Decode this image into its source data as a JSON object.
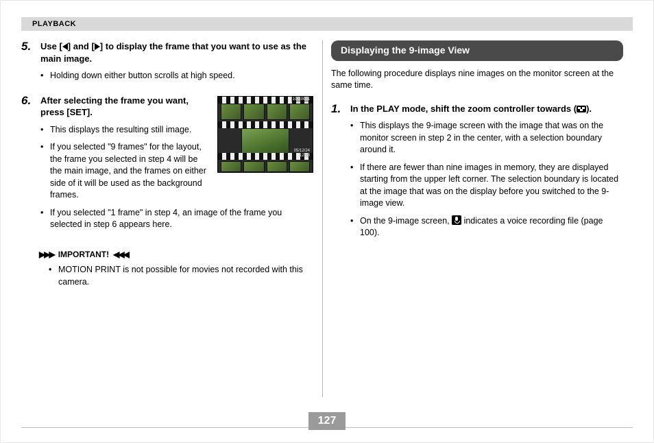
{
  "header": {
    "section": "PLAYBACK"
  },
  "page_number": "127",
  "left": {
    "step5": {
      "num": "5.",
      "head_pre": "Use [",
      "head_mid": "] and [",
      "head_post": "] to display the frame that you want to use as the main image.",
      "bullets": [
        "Holding down either button scrolls at high speed."
      ]
    },
    "step6": {
      "num": "6.",
      "head": "After selecting the frame you want, press [SET].",
      "bullets_a": [
        "This displays the resulting still image."
      ],
      "bullets_b": [
        "If you selected \"9 frames\" for the layout, the frame you selected in step 4 will be the main image, and the frames on either side of it will be used as the background frames.",
        "If you selected \"1 frame\" in step 4, an image of the frame you selected in step 6 appears here."
      ]
    },
    "thumb": {
      "top_overlay": "100-0001",
      "bottom_overlay_date": "05/12/24",
      "bottom_overlay_time": "12:38"
    },
    "important": {
      "label": "IMPORTANT!",
      "items": [
        "MOTION PRINT is not possible for movies not recorded with this camera."
      ]
    }
  },
  "right": {
    "section_title": "Displaying the 9-image View",
    "intro": "The following procedure displays nine images on the monitor screen at the same time.",
    "step1": {
      "num": "1.",
      "head_pre": "In the PLAY mode, shift the zoom controller towards (",
      "head_post": ").",
      "bullets_plain": [
        "This displays the 9-image screen with the image that was on the monitor screen in step 2 in the center, with a selection boundary around it.",
        "If there are fewer than nine images in memory, they are displayed starting from the upper left corner. The selection boundary is located at the image that was on the display before you switched to the 9-image view."
      ],
      "bullet_mic_pre": "On the 9-image screen, ",
      "bullet_mic_post": " indicates a voice recording file (page 100)."
    }
  }
}
